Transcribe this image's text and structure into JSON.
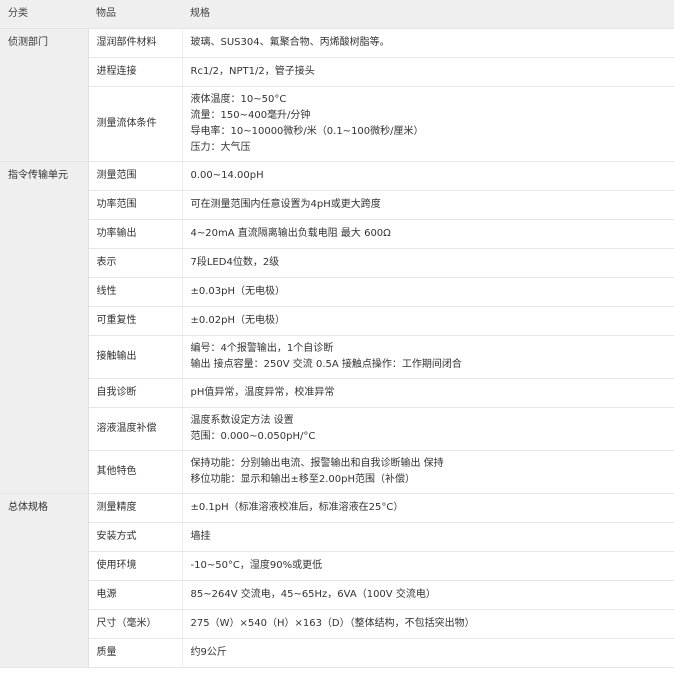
{
  "headers": [
    "分类",
    "物品",
    "规格"
  ],
  "groups": [
    {
      "category": "侦测部门",
      "rows": [
        {
          "item": "湿润部件材料",
          "spec": [
            "玻璃、SUS304、氟聚合物、丙烯酸树脂等。"
          ]
        },
        {
          "item": "进程连接",
          "spec": [
            "Rc1/2，NPT1/2，管子接头"
          ]
        },
        {
          "item": "测量流体条件",
          "spec": [
            "液体温度：10~50°C",
            "流量：150~400毫升/分钟",
            "导电率：10~10000微秒/米（0.1~100微秒/厘米）",
            "压力：大气压"
          ]
        }
      ]
    },
    {
      "category": "指令传输单元",
      "rows": [
        {
          "item": "测量范围",
          "spec": [
            "0.00~14.00pH"
          ]
        },
        {
          "item": "功率范围",
          "spec": [
            "可在测量范围内任意设置为4pH或更大跨度"
          ]
        },
        {
          "item": "功率输出",
          "spec": [
            "4~20mA 直流隔离输出负载电阻 最大 600Ω"
          ]
        },
        {
          "item": "表示",
          "spec": [
            "7段LED4位数，2级"
          ]
        },
        {
          "item": "线性",
          "spec": [
            "±0.03pH（无电极）"
          ]
        },
        {
          "item": "可重复性",
          "spec": [
            "±0.02pH（无电极）"
          ]
        },
        {
          "item": "接触输出",
          "spec": [
            "编号：4个报警输出，1个自诊断",
            "输出 接点容量：250V 交流 0.5A 接触点操作：工作期间闭合"
          ]
        },
        {
          "item": "自我诊断",
          "spec": [
            "pH值异常，温度异常，校准异常"
          ]
        },
        {
          "item": "溶液温度补偿",
          "spec": [
            "温度系数设定方法 设置",
            "范围：0.000~0.050pH/°C"
          ]
        },
        {
          "item": "其他特色",
          "spec": [
            "保持功能：分别输出电流、报警输出和自我诊断输出 保持",
            "移位功能：显示和输出±移至2.00pH范围（补偿）"
          ]
        }
      ]
    },
    {
      "category": "总体规格",
      "rows": [
        {
          "item": "测量精度",
          "spec": [
            "±0.1pH（标准溶液校准后，标准溶液在25°C）"
          ]
        },
        {
          "item": "安装方式",
          "spec": [
            "墙挂"
          ]
        },
        {
          "item": "使用环境",
          "spec": [
            "-10~50°C，湿度90%或更低"
          ]
        },
        {
          "item": "电源",
          "spec": [
            "85~264V 交流电，45~65Hz，6VA（100V 交流电）"
          ]
        },
        {
          "item": "尺寸（毫米）",
          "spec": [
            "275（W）×540（H）×163（D）（整体结构，不包括突出物）"
          ]
        },
        {
          "item": "质量",
          "spec": [
            "约9公斤"
          ]
        }
      ]
    }
  ]
}
